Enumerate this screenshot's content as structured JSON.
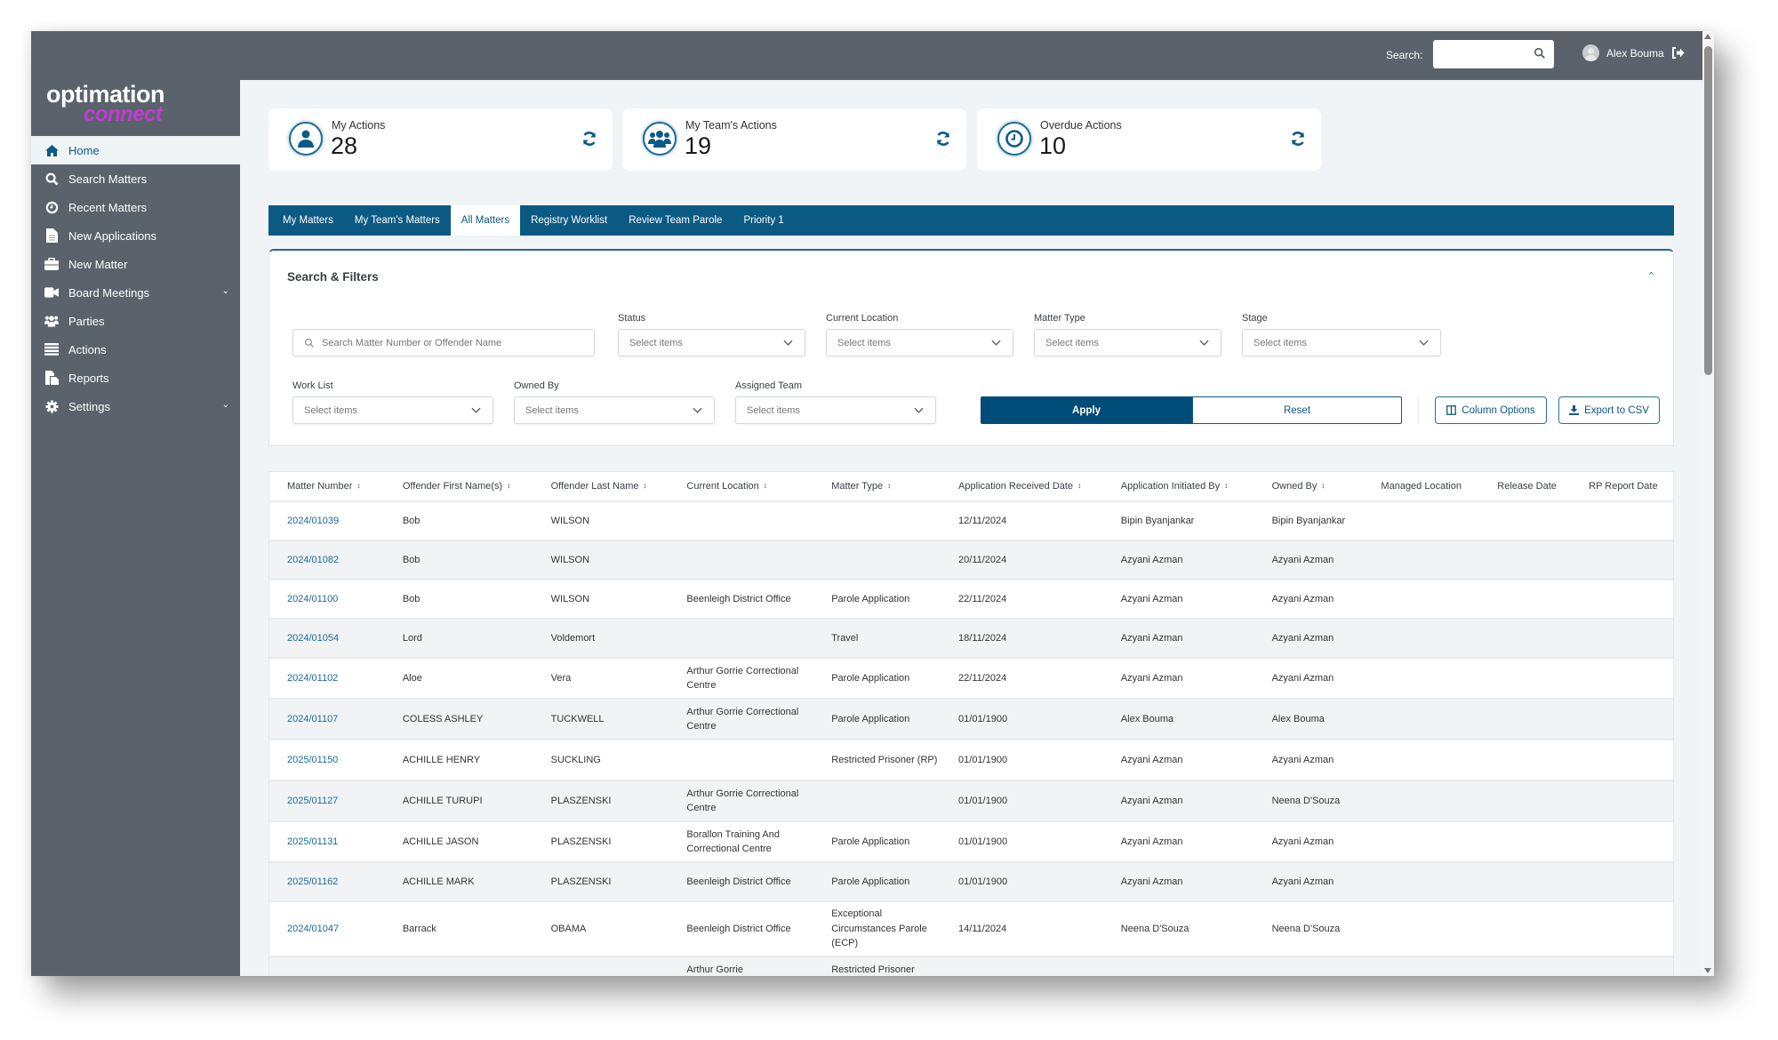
{
  "app": {
    "logo_line1": "optimation",
    "logo_line2": "connect",
    "brand_color": "#0b5a84",
    "accent_color": "#c13bd3"
  },
  "topbar": {
    "search_label": "Search:",
    "search_value": "",
    "user_name": "Alex Bouma"
  },
  "sidebar": {
    "items": [
      {
        "label": "Home",
        "icon": "home-icon",
        "active": true
      },
      {
        "label": "Search Matters",
        "icon": "search-icon"
      },
      {
        "label": "Recent Matters",
        "icon": "clock-icon"
      },
      {
        "label": "New Applications",
        "icon": "document-icon"
      },
      {
        "label": "New Matter",
        "icon": "briefcase-icon"
      },
      {
        "label": "Board Meetings",
        "icon": "video-icon",
        "expandable": true
      },
      {
        "label": "Parties",
        "icon": "users-icon"
      },
      {
        "label": "Actions",
        "icon": "list-icon"
      },
      {
        "label": "Reports",
        "icon": "reports-icon"
      },
      {
        "label": "Settings",
        "icon": "gear-icon",
        "expandable": true
      }
    ]
  },
  "cards": [
    {
      "title": "My Actions",
      "count": "28",
      "icon": "user-icon"
    },
    {
      "title": "My Team's Actions",
      "count": "19",
      "icon": "team-icon"
    },
    {
      "title": "Overdue Actions",
      "count": "10",
      "icon": "clock-icon"
    }
  ],
  "tabs": [
    {
      "label": "My Matters"
    },
    {
      "label": "My Team's Matters"
    },
    {
      "label": "All Matters",
      "active": true
    },
    {
      "label": "Registry Worklist"
    },
    {
      "label": "Review Team Parole"
    },
    {
      "label": "Priority 1"
    }
  ],
  "filters": {
    "title": "Search & Filters",
    "search_placeholder": "Search Matter Number or Offender Name",
    "status_label": "Status",
    "current_location_label": "Current Location",
    "matter_type_label": "Matter Type",
    "stage_label": "Stage",
    "work_list_label": "Work List",
    "owned_by_label": "Owned By",
    "assigned_team_label": "Assigned Team",
    "select_placeholder": "Select items",
    "apply_label": "Apply",
    "reset_label": "Reset",
    "column_options_label": "Column Options",
    "export_label": "Export to CSV"
  },
  "table": {
    "columns": [
      {
        "label": "Matter Number",
        "sortable": true
      },
      {
        "label": "Offender First Name(s)",
        "sortable": true
      },
      {
        "label": "Offender Last Name",
        "sortable": true
      },
      {
        "label": "Current Location",
        "sortable": true
      },
      {
        "label": "Matter Type",
        "sortable": true
      },
      {
        "label": "Application Received Date",
        "sortable": true
      },
      {
        "label": "Application Initiated By",
        "sortable": true
      },
      {
        "label": "Owned By",
        "sortable": true
      },
      {
        "label": "Managed Location",
        "sortable": false
      },
      {
        "label": "Release Date",
        "sortable": false
      },
      {
        "label": "RP Report Date",
        "sortable": false
      }
    ],
    "rows": [
      [
        "2024/01039",
        "Bob",
        "WILSON",
        "",
        "",
        "12/11/2024",
        "Bipin Byanjankar",
        "Bipin Byanjankar",
        "",
        "",
        ""
      ],
      [
        "2024/01082",
        "Bob",
        "WILSON",
        "",
        "",
        "20/11/2024",
        "Azyani Azman",
        "Azyani Azman",
        "",
        "",
        ""
      ],
      [
        "2024/01100",
        "Bob",
        "WILSON",
        "Beenleigh District Office",
        "Parole Application",
        "22/11/2024",
        "Azyani Azman",
        "Azyani Azman",
        "",
        "",
        ""
      ],
      [
        "2024/01054",
        "Lord",
        "Voldemort",
        "",
        "Travel",
        "18/11/2024",
        "Azyani Azman",
        "Azyani Azman",
        "",
        "",
        ""
      ],
      [
        "2024/01102",
        "Aloe",
        "Vera",
        "Arthur Gorrie Correctional Centre",
        "Parole Application",
        "22/11/2024",
        "Azyani Azman",
        "Azyani Azman",
        "",
        "",
        ""
      ],
      [
        "2024/01107",
        "COLESS ASHLEY",
        "TUCKWELL",
        "Arthur Gorrie Correctional Centre",
        "Parole Application",
        "01/01/1900",
        "Alex Bouma",
        "Alex Bouma",
        "",
        "",
        ""
      ],
      [
        "2025/01150",
        "ACHILLE HENRY",
        "SUCKLING",
        "",
        "Restricted Prisoner (RP)",
        "01/01/1900",
        "Azyani Azman",
        "Azyani Azman",
        "",
        "",
        ""
      ],
      [
        "2025/01127",
        "ACHILLE TURUPI",
        "PLASZENSKI",
        "Arthur Gorrie Correctional Centre",
        "",
        "01/01/1900",
        "Azyani Azman",
        "Neena D'Souza",
        "",
        "",
        ""
      ],
      [
        "2025/01131",
        "ACHILLE JASON",
        "PLASZENSKI",
        "Borallon Training And Correctional Centre",
        "Parole Application",
        "01/01/1900",
        "Azyani Azman",
        "Azyani Azman",
        "",
        "",
        ""
      ],
      [
        "2025/01162",
        "ACHILLE MARK",
        "PLASZENSKI",
        "Beenleigh District Office",
        "Parole Application",
        "01/01/1900",
        "Azyani Azman",
        "Azyani Azman",
        "",
        "",
        ""
      ],
      [
        "2024/01047",
        "Barrack",
        "OBAMA",
        "Beenleigh District Office",
        "Exceptional Circumstances Parole (ECP)",
        "14/11/2024",
        "Neena D'Souza",
        "Neena D'Souza",
        "",
        "",
        ""
      ],
      [
        "",
        "",
        "",
        "Arthur Gorrie",
        "Restricted Prisoner",
        "",
        "",
        "",
        "",
        "",
        ""
      ]
    ]
  }
}
